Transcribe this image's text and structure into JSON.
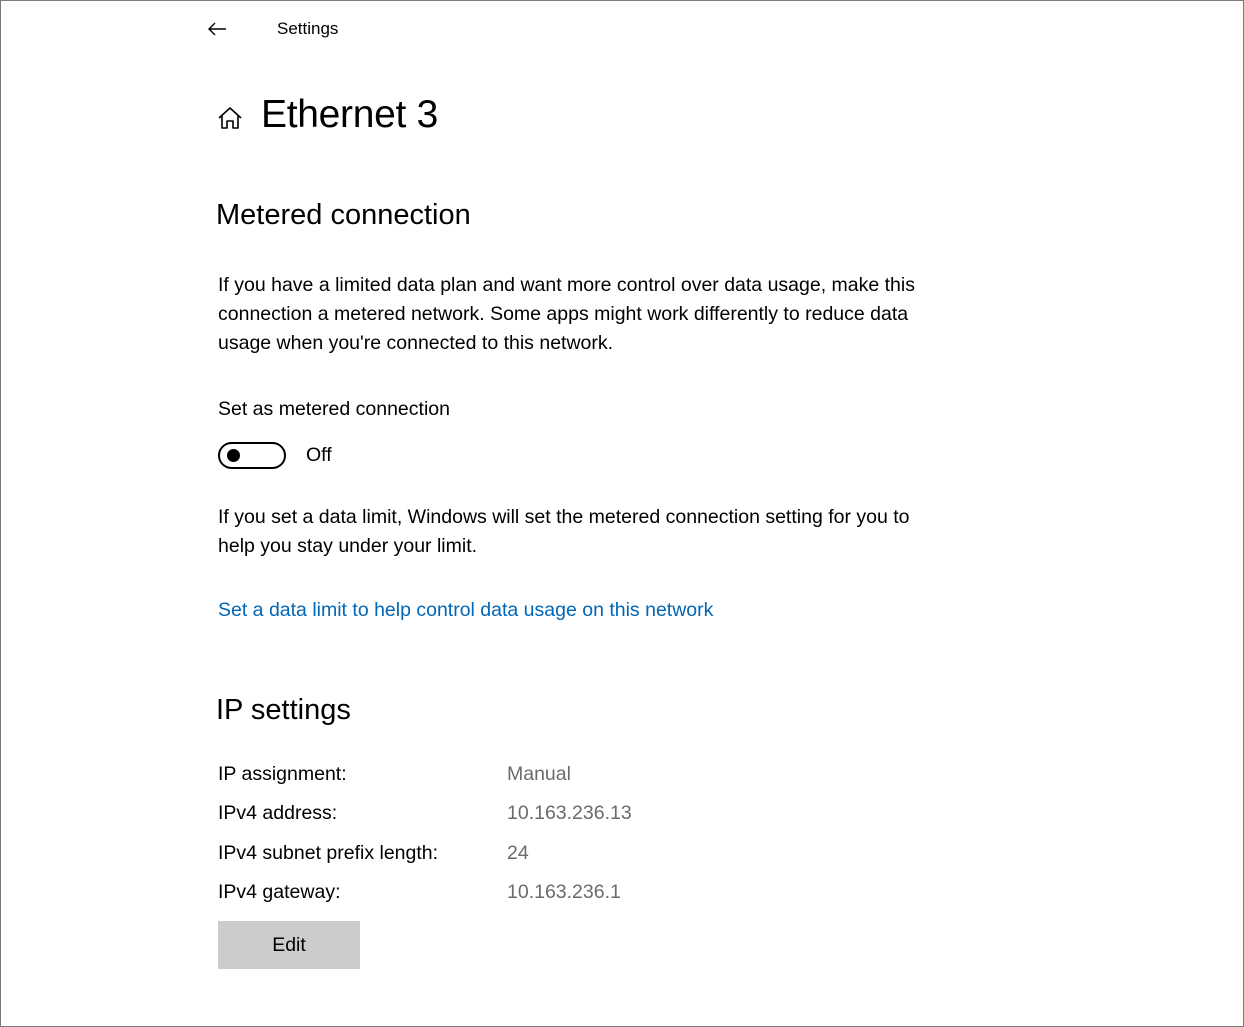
{
  "window": {
    "title": "Settings"
  },
  "page": {
    "title": "Ethernet 3"
  },
  "metered": {
    "heading": "Metered connection",
    "description": "If you have a limited data plan and want more control over data usage, make this connection a metered network. Some apps might work differently to reduce data usage when you're connected to this network.",
    "toggle_label": "Set as metered connection",
    "toggle_state": "Off",
    "toggle_on": false,
    "limit_description": "If you set a data limit, Windows will set the metered connection setting for you to help you stay under your limit.",
    "limit_link": "Set a data limit to help control data usage on this network"
  },
  "ip": {
    "heading": "IP settings",
    "rows": [
      {
        "label": "IP assignment:",
        "value": "Manual"
      },
      {
        "label": "IPv4 address:",
        "value": "10.163.236.13"
      },
      {
        "label": "IPv4 subnet prefix length:",
        "value": "24"
      },
      {
        "label": "IPv4 gateway:",
        "value": "10.163.236.1"
      }
    ],
    "edit_label": "Edit"
  },
  "colors": {
    "link": "#0067b8",
    "value_text": "#6b6b6b",
    "button_bg": "#cccccc"
  },
  "icons": {
    "back": "back-arrow-icon",
    "home": "home-icon"
  }
}
